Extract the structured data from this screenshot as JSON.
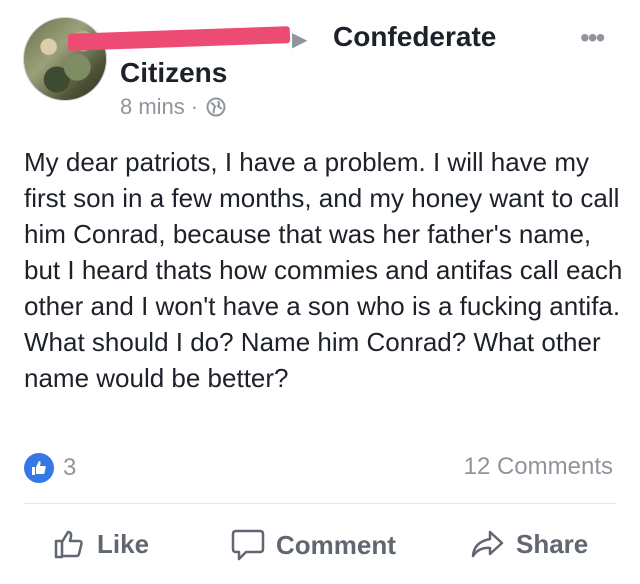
{
  "post": {
    "author_redacted": "",
    "group_name_line1": "Confederate",
    "group_name_line2": "Citizens",
    "timestamp": "8 mins",
    "separator": "·",
    "body": "My dear patriots, I have a problem. I will have my first son in a few months, and my honey want to call him Conrad, because that was her father's name, but I heard thats how commies and antifas call each other and I won't have a son who is a fucking antifa. What should I do? Name him Conrad? What other name would be better?"
  },
  "reactions": {
    "like_count": "3",
    "comments_label": "12 Comments"
  },
  "actions": {
    "like": "Like",
    "comment": "Comment",
    "share": "Share"
  },
  "icons": {
    "more": "more-dots-icon",
    "privacy": "globe-icon",
    "like_badge": "thumbs-up-icon",
    "like": "thumbs-up-outline-icon",
    "comment": "speech-bubble-icon",
    "share": "share-arrow-icon"
  },
  "colors": {
    "accent": "#3578e5",
    "redaction": "#ec4b74",
    "muted": "#90949c",
    "text": "#1d2129"
  }
}
